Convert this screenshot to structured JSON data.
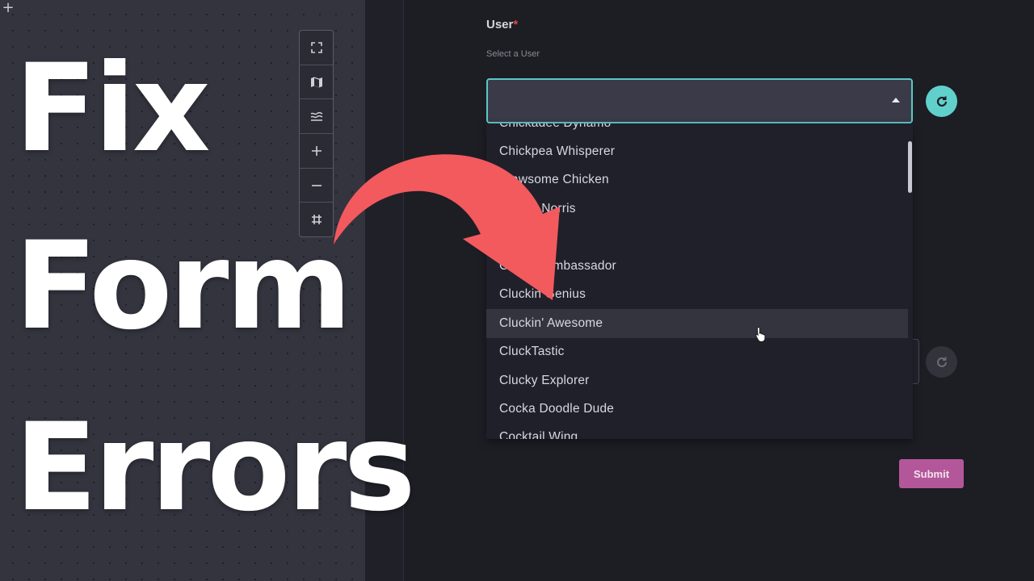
{
  "canvas": {
    "corner_icon": "plus-icon",
    "toolbar": [
      {
        "icon": "fullscreen-icon"
      },
      {
        "icon": "map-icon"
      },
      {
        "icon": "layers-icon"
      },
      {
        "icon": "zoom-in-icon"
      },
      {
        "icon": "zoom-out-icon"
      },
      {
        "icon": "grid-icon"
      }
    ]
  },
  "form": {
    "user_label": "User",
    "required_mark": "*",
    "user_hint": "Select a User",
    "select_value": "",
    "refresh_icon": "refresh-icon",
    "submit_label": "Submit"
  },
  "dropdown": {
    "items": [
      "Chickadee Dynamo",
      "Chickpea Whisperer",
      "Clawsome Chicken",
      "Clucky Norris",
      "",
      "Cluckin Ambassador",
      "Cluckin Genius",
      "Cluckin' Awesome",
      "CluckTastic",
      "Clucky Explorer",
      "Cocka Doodle Dude",
      "Cocktail Wing"
    ],
    "hovered_index": 7
  },
  "overlay": {
    "title_lines": [
      "Fix",
      "Form",
      "Errors"
    ],
    "arrow_color": "#f25a5e"
  },
  "colors": {
    "accent": "#61d0cc",
    "submit": "#b3579a",
    "required": "#e04a4a"
  }
}
